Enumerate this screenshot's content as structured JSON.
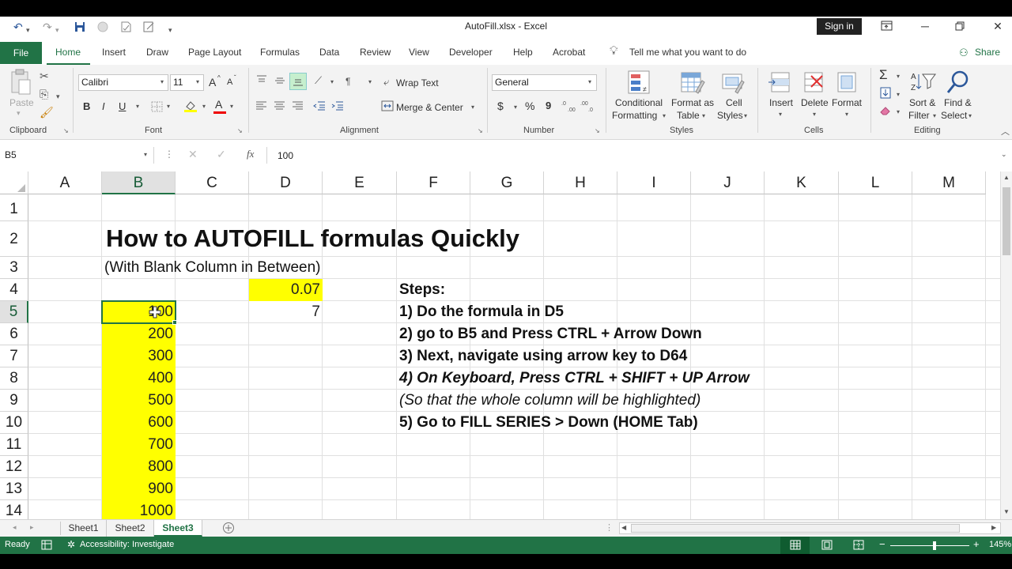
{
  "window": {
    "title": "AutoFill.xlsx  -  Excel",
    "signin": "Sign in"
  },
  "qat": {
    "undo_icon": "↶",
    "redo_icon": "↷"
  },
  "tabs": {
    "file": "File",
    "home": "Home",
    "insert": "Insert",
    "draw": "Draw",
    "page_layout": "Page Layout",
    "formulas": "Formulas",
    "data": "Data",
    "review": "Review",
    "view": "View",
    "developer": "Developer",
    "help": "Help",
    "acrobat": "Acrobat",
    "tell_me": "Tell me what you want to do",
    "share": "Share"
  },
  "ribbon": {
    "clipboard": {
      "label": "Clipboard",
      "paste": "Paste"
    },
    "font": {
      "label": "Font",
      "name": "Calibri",
      "size": "11",
      "grow": "A",
      "shrink": "A",
      "bold": "B",
      "italic": "I",
      "underline": "U"
    },
    "alignment": {
      "label": "Alignment",
      "wrap_text": "Wrap Text",
      "merge_center": "Merge & Center"
    },
    "number": {
      "label": "Number",
      "format": "General",
      "currency": "$",
      "percent": "%",
      "comma": "9"
    },
    "styles": {
      "label": "Styles",
      "conditional": "Conditional",
      "formatting": "Formatting",
      "format_as": "Format as",
      "table": "Table",
      "cell": "Cell",
      "cell_styles": "Styles"
    },
    "cells": {
      "label": "Cells",
      "insert": "Insert",
      "delete": "Delete",
      "format": "Format"
    },
    "editing": {
      "label": "Editing",
      "sort": "Sort &",
      "filter": "Filter",
      "find": "Find &",
      "select": "Select"
    }
  },
  "formula_bar": {
    "name_box": "B5",
    "fx": "fx",
    "value": "100"
  },
  "columns": [
    "A",
    "B",
    "C",
    "D",
    "E",
    "F",
    "G",
    "H",
    "I",
    "J",
    "K",
    "L",
    "M"
  ],
  "rows": [
    "1",
    "2",
    "3",
    "4",
    "5",
    "6",
    "7",
    "8",
    "9",
    "10",
    "11",
    "12",
    "13",
    "14"
  ],
  "cells": {
    "B2": "How to AUTOFILL formulas Quickly",
    "B3": "(With Blank Column in Between)",
    "D4": "0.07",
    "D5": "7",
    "B_values": [
      "100",
      "200",
      "300",
      "400",
      "500",
      "600",
      "700",
      "800",
      "900",
      "1000"
    ],
    "F4": "Steps:",
    "F5": "1) Do the formula in D5",
    "F6": "2) go to B5 and Press CTRL + Arrow Down",
    "F7": "3) Next, navigate using arrow key to D64",
    "F8": "4) On Keyboard, Press CTRL + SHIFT + UP Arrow",
    "F9": "(So that the whole column will be highlighted)",
    "F10": "5) Go to FILL SERIES > Down (HOME Tab)"
  },
  "sheets": [
    "Sheet1",
    "Sheet2",
    "Sheet3"
  ],
  "active_sheet": "Sheet3",
  "status": {
    "ready": "Ready",
    "accessibility": "Accessibility: Investigate",
    "zoom": "145%"
  },
  "colors": {
    "excel_green": "#217346",
    "highlight": "#ffff00"
  }
}
